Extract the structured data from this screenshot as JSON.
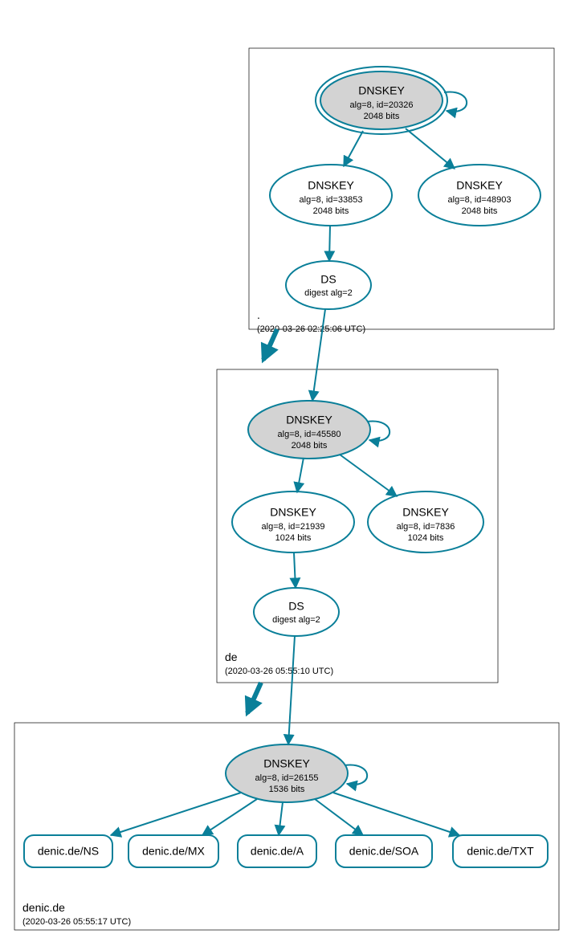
{
  "colors": {
    "accent": "#0a7f99",
    "node_fill": "#d3d3d3"
  },
  "zones": {
    "root": {
      "name": ".",
      "timestamp": "(2020-03-26 02:25:06 UTC)",
      "ksk": {
        "title": "DNSKEY",
        "sub1": "alg=8, id=20326",
        "sub2": "2048 bits"
      },
      "zsk": {
        "title": "DNSKEY",
        "sub1": "alg=8, id=33853",
        "sub2": "2048 bits"
      },
      "k3": {
        "title": "DNSKEY",
        "sub1": "alg=8, id=48903",
        "sub2": "2048 bits"
      },
      "ds": {
        "title": "DS",
        "sub1": "digest alg=2"
      }
    },
    "de": {
      "name": "de",
      "timestamp": "(2020-03-26 05:55:10 UTC)",
      "ksk": {
        "title": "DNSKEY",
        "sub1": "alg=8, id=45580",
        "sub2": "2048 bits"
      },
      "zsk": {
        "title": "DNSKEY",
        "sub1": "alg=8, id=21939",
        "sub2": "1024 bits"
      },
      "k3": {
        "title": "DNSKEY",
        "sub1": "alg=8, id=7836",
        "sub2": "1024 bits"
      },
      "ds": {
        "title": "DS",
        "sub1": "digest alg=2"
      }
    },
    "denic": {
      "name": "denic.de",
      "timestamp": "(2020-03-26 05:55:17 UTC)",
      "ksk": {
        "title": "DNSKEY",
        "sub1": "alg=8, id=26155",
        "sub2": "1536 bits"
      },
      "rr": {
        "ns": "denic.de/NS",
        "mx": "denic.de/MX",
        "a": "denic.de/A",
        "soa": "denic.de/SOA",
        "txt": "denic.de/TXT"
      }
    }
  }
}
